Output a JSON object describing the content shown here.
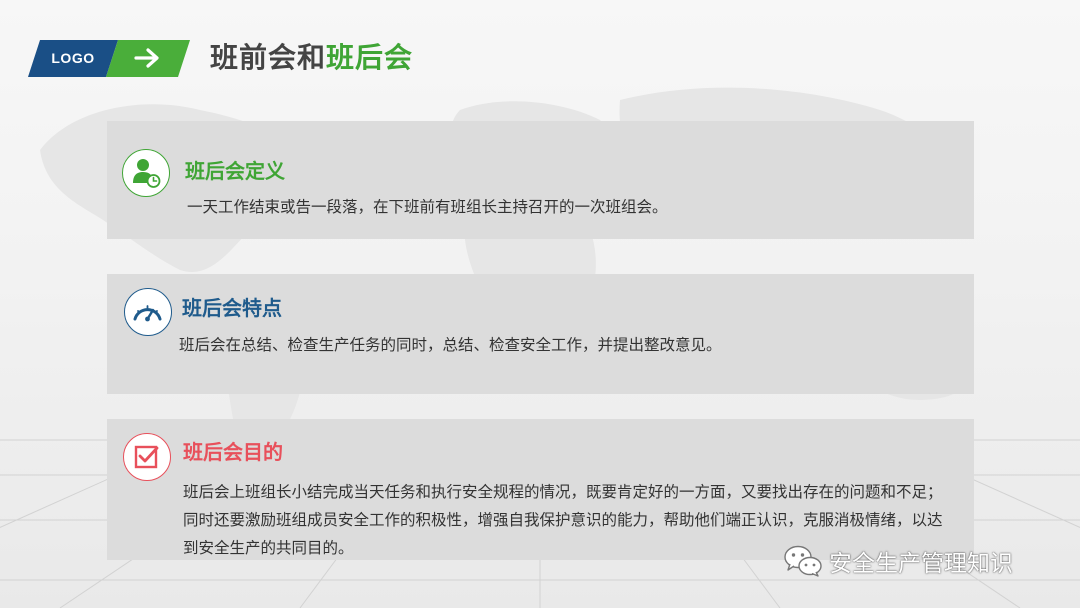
{
  "header": {
    "logo_text": "LOGO",
    "title_part1": "班前会和",
    "title_part2": "班后会"
  },
  "colors": {
    "logo_blue": "#1a4f86",
    "accent_green": "#3fa535",
    "feature_blue": "#1f5b8c",
    "purpose_red": "#e8505b",
    "card_gray": "#dcdcdc"
  },
  "cards": [
    {
      "icon": "person-clock-icon",
      "title": "班后会定义",
      "body": "一天工作结束或告一段落，在下班前有班组长主持召开的一次班组会。"
    },
    {
      "icon": "speedometer-icon",
      "title": "班后会特点",
      "body": "班后会在总结、检查生产任务的同时，总结、检查安全工作，并提出整改意见。"
    },
    {
      "icon": "checkbox-icon",
      "title": "班后会目的",
      "body": "班后会上班组长小结完成当天任务和执行安全规程的情况，既要肯定好的一方面，又要找出存在的问题和不足；同时还要激励班组成员安全工作的积极性，增强自我保护意识的能力，帮助他们端正认识，克服消极情绪，以达到安全生产的共同目的。"
    }
  ],
  "watermark": {
    "icon": "wechat-icon",
    "text": "安全生产管理知识"
  }
}
